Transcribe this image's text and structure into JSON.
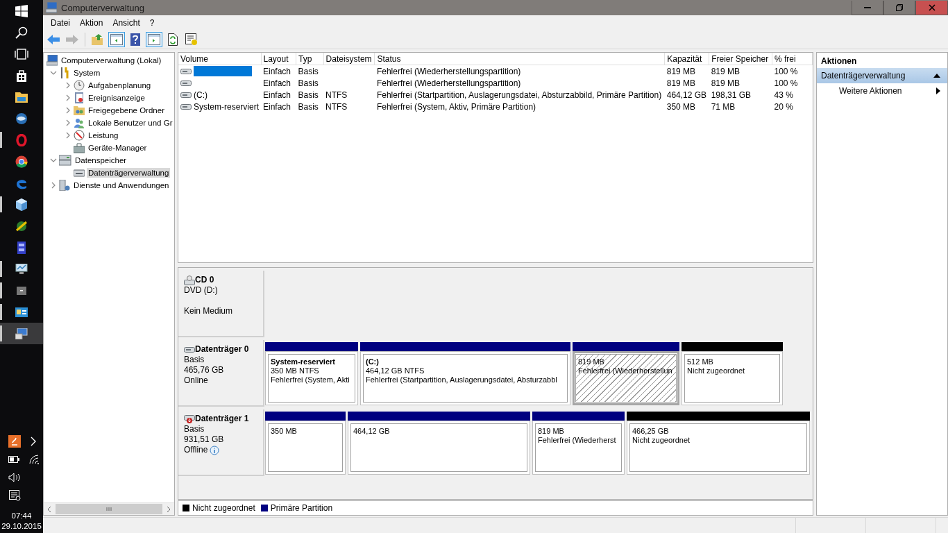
{
  "taskbar": {
    "apps": [
      {
        "open": false,
        "selected": false
      },
      {
        "open": false,
        "selected": false
      },
      {
        "open": false,
        "selected": false
      },
      {
        "open": false,
        "selected": false
      },
      {
        "open": false,
        "selected": false
      },
      {
        "open": false,
        "selected": false
      },
      {
        "open": true,
        "selected": false
      },
      {
        "open": false,
        "selected": false
      },
      {
        "open": false,
        "selected": false
      },
      {
        "open": true,
        "selected": false
      },
      {
        "open": false,
        "selected": false
      },
      {
        "open": false,
        "selected": false
      },
      {
        "open": true,
        "selected": false
      },
      {
        "open": true,
        "selected": false
      },
      {
        "open": true,
        "selected": false
      },
      {
        "open": true,
        "selected": true
      }
    ],
    "clock": {
      "time": "07:44",
      "date": "29.10.2015"
    }
  },
  "window": {
    "title": "Computerverwaltung"
  },
  "menu": [
    "Datei",
    "Aktion",
    "Ansicht",
    "?"
  ],
  "toolbar": [
    {
      "disabled": false,
      "pressed": false
    },
    {
      "disabled": true,
      "pressed": false
    },
    {
      "disabled": false,
      "pressed": false
    },
    {
      "disabled": false,
      "pressed": true
    },
    {
      "disabled": false,
      "pressed": false
    },
    {
      "disabled": false,
      "pressed": true
    },
    {
      "disabled": false,
      "pressed": false
    },
    {
      "disabled": false,
      "pressed": false
    }
  ],
  "tree": [
    {
      "label": "Computerverwaltung (Lokal)",
      "selected": false,
      "children": [
        {
          "label": "System",
          "expanded": true,
          "selected": false,
          "children": [
            {
              "label": "Aufgabenplanung",
              "expanded": false,
              "selected": false
            },
            {
              "label": "Ereignisanzeige",
              "expanded": false,
              "selected": false
            },
            {
              "label": "Freigegebene Ordner",
              "expanded": false,
              "selected": false
            },
            {
              "label": "Lokale Benutzer und Gr",
              "expanded": false,
              "selected": false
            },
            {
              "label": "Leistung",
              "expanded": false,
              "selected": false
            },
            {
              "label": "Geräte-Manager",
              "selected": false
            }
          ]
        },
        {
          "label": "Datenspeicher",
          "expanded": true,
          "selected": false,
          "children": [
            {
              "label": "Datenträgerverwaltung",
              "selected": true
            }
          ]
        },
        {
          "label": "Dienste und Anwendungen",
          "expanded": false,
          "selected": false
        }
      ]
    }
  ],
  "volumes": {
    "columns": [
      "Volume",
      "Layout",
      "Typ",
      "Dateisystem",
      "Status",
      "Kapazität",
      "Freier Speicher",
      "% frei"
    ],
    "rows": [
      {
        "selected": true,
        "layout": "Einfach",
        "type": "Basis",
        "status": "Fehlerfrei (Wiederherstellungspartition)",
        "capacity": "819 MB",
        "free": "819 MB",
        "percent_free": "100 %"
      },
      {
        "selected": false,
        "layout": "Einfach",
        "type": "Basis",
        "status": "Fehlerfrei (Wiederherstellungspartition)",
        "capacity": "819 MB",
        "free": "819 MB",
        "percent_free": "100 %"
      },
      {
        "selected": false,
        "volume": "(C:)",
        "layout": "Einfach",
        "type": "Basis",
        "filesystem": "NTFS",
        "status": "Fehlerfrei (Startpartition, Auslagerungsdatei, Absturzabbild, Primäre Partition)",
        "capacity": "464,12 GB",
        "free": "198,31 GB",
        "percent_free": "43 %"
      },
      {
        "selected": false,
        "volume": "System-reserviert",
        "layout": "Einfach",
        "type": "Basis",
        "filesystem": "NTFS",
        "status": "Fehlerfrei (System, Aktiv, Primäre Partition)",
        "capacity": "350 MB",
        "free": "71 MB",
        "percent_free": "20 %"
      }
    ]
  },
  "disks": [
    {
      "kind": "cd",
      "name": "CD 0",
      "lines": [
        "DVD (D:)",
        "Kein Medium"
      ]
    },
    {
      "kind": "disk",
      "name": "Datenträger 0",
      "lines": [
        "Basis",
        "465,76 GB",
        "Online"
      ],
      "partitions": [
        {
          "color": "#000080",
          "selected": false,
          "name": "System-reserviert",
          "lines": [
            "350 MB NTFS",
            "Fehlerfrei (System, Akti"
          ]
        },
        {
          "color": "#000080",
          "selected": false,
          "name": "(C:)",
          "lines": [
            "464,12 GB NTFS",
            "Fehlerfrei (Startpartition, Auslagerungsdatei, Absturzabbl"
          ]
        },
        {
          "color": "#000080",
          "selected": true,
          "lines": [
            "819 MB",
            "Fehlerfrei (Wiederherstellun"
          ]
        },
        {
          "color": "#000000",
          "selected": false,
          "lines": [
            "512 MB",
            "Nicht zugeordnet"
          ]
        }
      ]
    },
    {
      "kind": "offline",
      "name": "Datenträger 1",
      "lines": [
        "Basis",
        "931,51 GB",
        "Offline"
      ],
      "partitions": [
        {
          "color": "#000080",
          "selected": false,
          "lines": [
            "350 MB"
          ]
        },
        {
          "color": "#000080",
          "selected": false,
          "lines": [
            "464,12 GB"
          ]
        },
        {
          "color": "#000080",
          "selected": false,
          "lines": [
            "819 MB",
            "Fehlerfrei (Wiederherst"
          ]
        },
        {
          "color": "#000000",
          "selected": false,
          "lines": [
            "466,25 GB",
            "Nicht zugeordnet"
          ]
        }
      ]
    }
  ],
  "legend": [
    {
      "label": "Nicht zugeordnet",
      "color": "#000000"
    },
    {
      "label": "Primäre Partition",
      "color": "#000080"
    }
  ],
  "actions": {
    "title": "Aktionen",
    "sections": [
      {
        "label": "Datenträgerverwaltung",
        "expanded": true,
        "items": [
          "Weitere Aktionen"
        ]
      }
    ]
  }
}
